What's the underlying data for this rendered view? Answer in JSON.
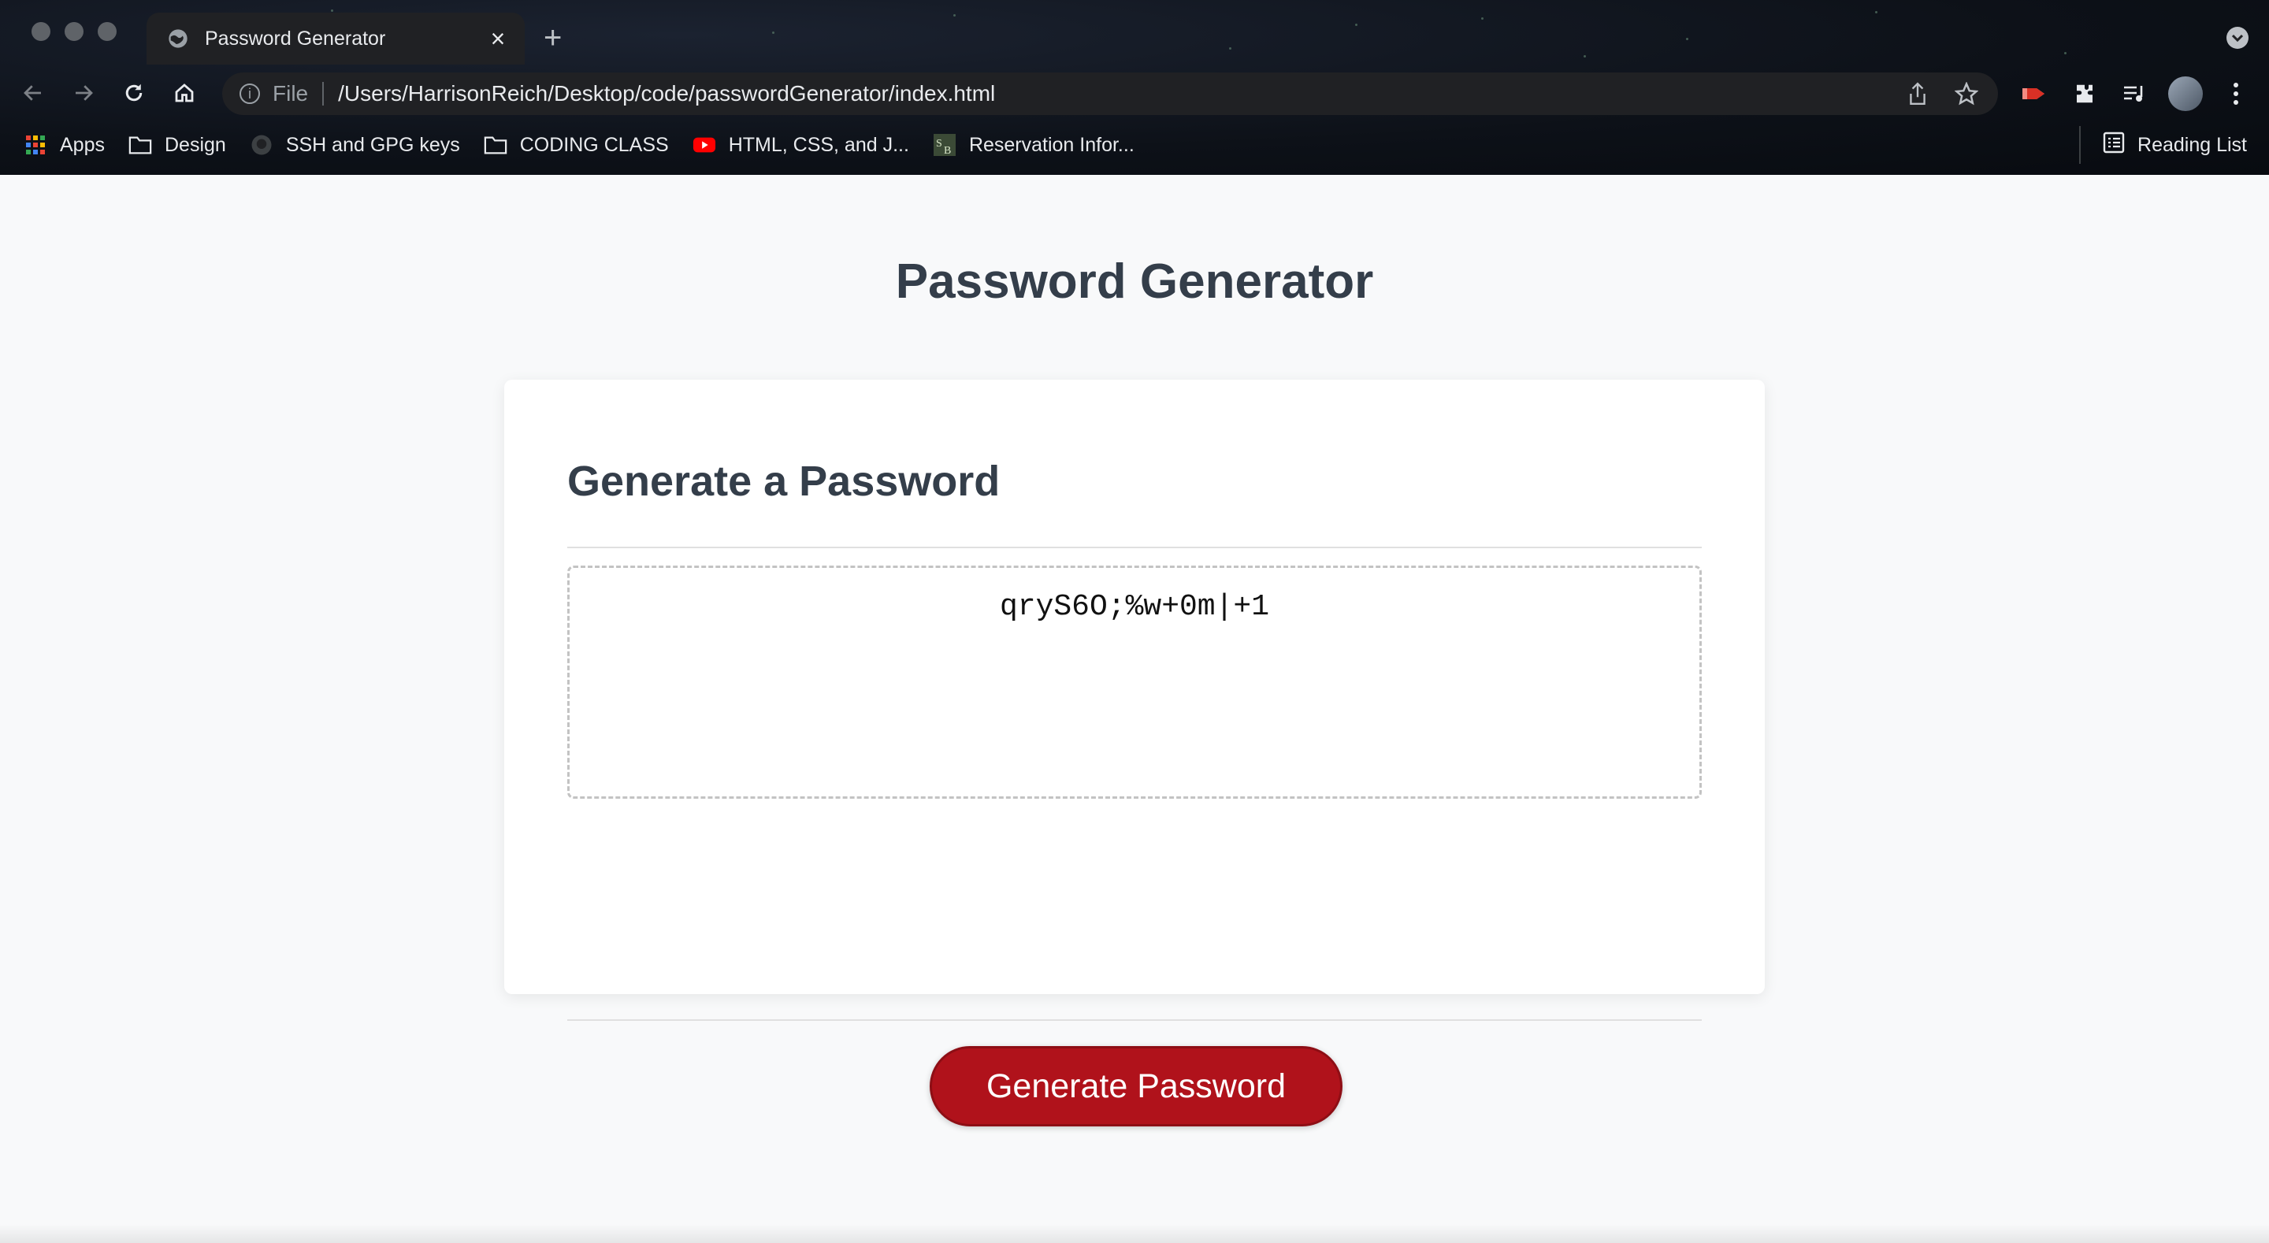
{
  "browser": {
    "tab_title": "Password Generator",
    "tab_close_glyph": "×",
    "new_tab_glyph": "+",
    "address_scheme": "File",
    "address_url": "/Users/HarrisonReich/Desktop/code/passwordGenerator/index.html",
    "bookmarks": [
      {
        "label": "Apps",
        "icon": "apps-grid-icon"
      },
      {
        "label": "Design",
        "icon": "folder-icon"
      },
      {
        "label": "SSH and GPG keys",
        "icon": "github-icon"
      },
      {
        "label": "CODING CLASS",
        "icon": "folder-icon"
      },
      {
        "label": "HTML, CSS, and J...",
        "icon": "youtube-icon"
      },
      {
        "label": "Reservation Infor...",
        "icon": "sb-site-icon"
      }
    ],
    "reading_list": "Reading List"
  },
  "page": {
    "title": "Password Generator",
    "card_title": "Generate a Password",
    "password_value": "qryS6O;%w+0m|+1",
    "generate_button": "Generate Password"
  },
  "colors": {
    "button_red": "#b0121b",
    "heading": "#343e4a",
    "page_bg": "#f8f9fa"
  }
}
